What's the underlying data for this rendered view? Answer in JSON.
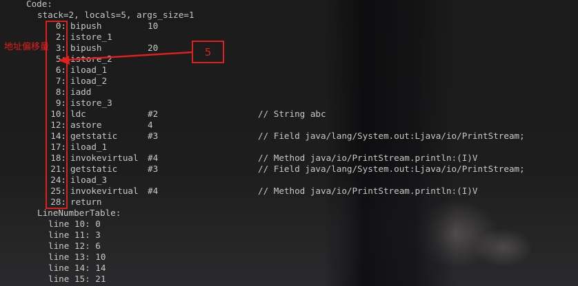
{
  "header": {
    "code_label": "Code:",
    "stack_info": "stack=2, locals=5, args_size=1"
  },
  "instructions": [
    {
      "offset": "0",
      "op": "bipush",
      "arg": "10",
      "comment": ""
    },
    {
      "offset": "2",
      "op": "istore_1",
      "arg": "",
      "comment": ""
    },
    {
      "offset": "3",
      "op": "bipush",
      "arg": "20",
      "comment": ""
    },
    {
      "offset": "5",
      "op": "istore_2",
      "arg": "",
      "comment": ""
    },
    {
      "offset": "6",
      "op": "iload_1",
      "arg": "",
      "comment": ""
    },
    {
      "offset": "7",
      "op": "iload_2",
      "arg": "",
      "comment": ""
    },
    {
      "offset": "8",
      "op": "iadd",
      "arg": "",
      "comment": ""
    },
    {
      "offset": "9",
      "op": "istore_3",
      "arg": "",
      "comment": ""
    },
    {
      "offset": "10",
      "op": "ldc",
      "arg": "#2",
      "comment": "// String abc"
    },
    {
      "offset": "12",
      "op": "astore",
      "arg": "4",
      "comment": ""
    },
    {
      "offset": "14",
      "op": "getstatic",
      "arg": "#3",
      "comment": "// Field java/lang/System.out:Ljava/io/PrintStream;"
    },
    {
      "offset": "17",
      "op": "iload_1",
      "arg": "",
      "comment": ""
    },
    {
      "offset": "18",
      "op": "invokevirtual",
      "arg": "#4",
      "comment": "// Method java/io/PrintStream.println:(I)V"
    },
    {
      "offset": "21",
      "op": "getstatic",
      "arg": "#3",
      "comment": "// Field java/lang/System.out:Ljava/io/PrintStream;"
    },
    {
      "offset": "24",
      "op": "iload_3",
      "arg": "",
      "comment": ""
    },
    {
      "offset": "25",
      "op": "invokevirtual",
      "arg": "#4",
      "comment": "// Method java/io/PrintStream.println:(I)V"
    },
    {
      "offset": "28",
      "op": "return",
      "arg": "",
      "comment": ""
    }
  ],
  "line_number_table": {
    "label": "LineNumberTable:",
    "entries": [
      "line 10: 0",
      "line 11: 3",
      "line 12: 6",
      "line 13: 10",
      "line 14: 14",
      "line 15: 21"
    ]
  },
  "annotation": {
    "label": "地址偏移量",
    "callout_value": "5",
    "color": "#e0201c"
  },
  "colors": {
    "text": "#c8c8c8",
    "background": "#1a1a1a"
  }
}
